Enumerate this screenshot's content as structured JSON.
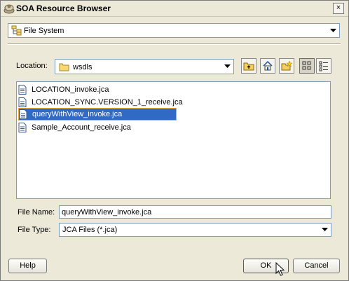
{
  "window": {
    "title": "SOA Resource Browser",
    "close_symbol": "×"
  },
  "source_selector": {
    "value": "File System",
    "icon": "file-system-icon"
  },
  "location": {
    "label": "Location:",
    "value": "wsdls",
    "toolbar": [
      "up-folder-icon",
      "home-icon",
      "new-folder-icon",
      "list-view-icon",
      "details-view-icon"
    ]
  },
  "files": [
    {
      "name": "LOCATION_invoke.jca",
      "selected": false
    },
    {
      "name": "LOCATION_SYNC.VERSION_1_receive.jca",
      "selected": false
    },
    {
      "name": "queryWithView_invoke.jca",
      "selected": true
    },
    {
      "name": "Sample_Account_receive.jca",
      "selected": false
    }
  ],
  "file_name": {
    "label": "File Name:",
    "value": "queryWithView_invoke.jca"
  },
  "file_type": {
    "label": "File Type:",
    "value": "JCA Files (*.jca)"
  },
  "buttons": {
    "help": "Help",
    "ok": "OK",
    "cancel": "Cancel"
  }
}
